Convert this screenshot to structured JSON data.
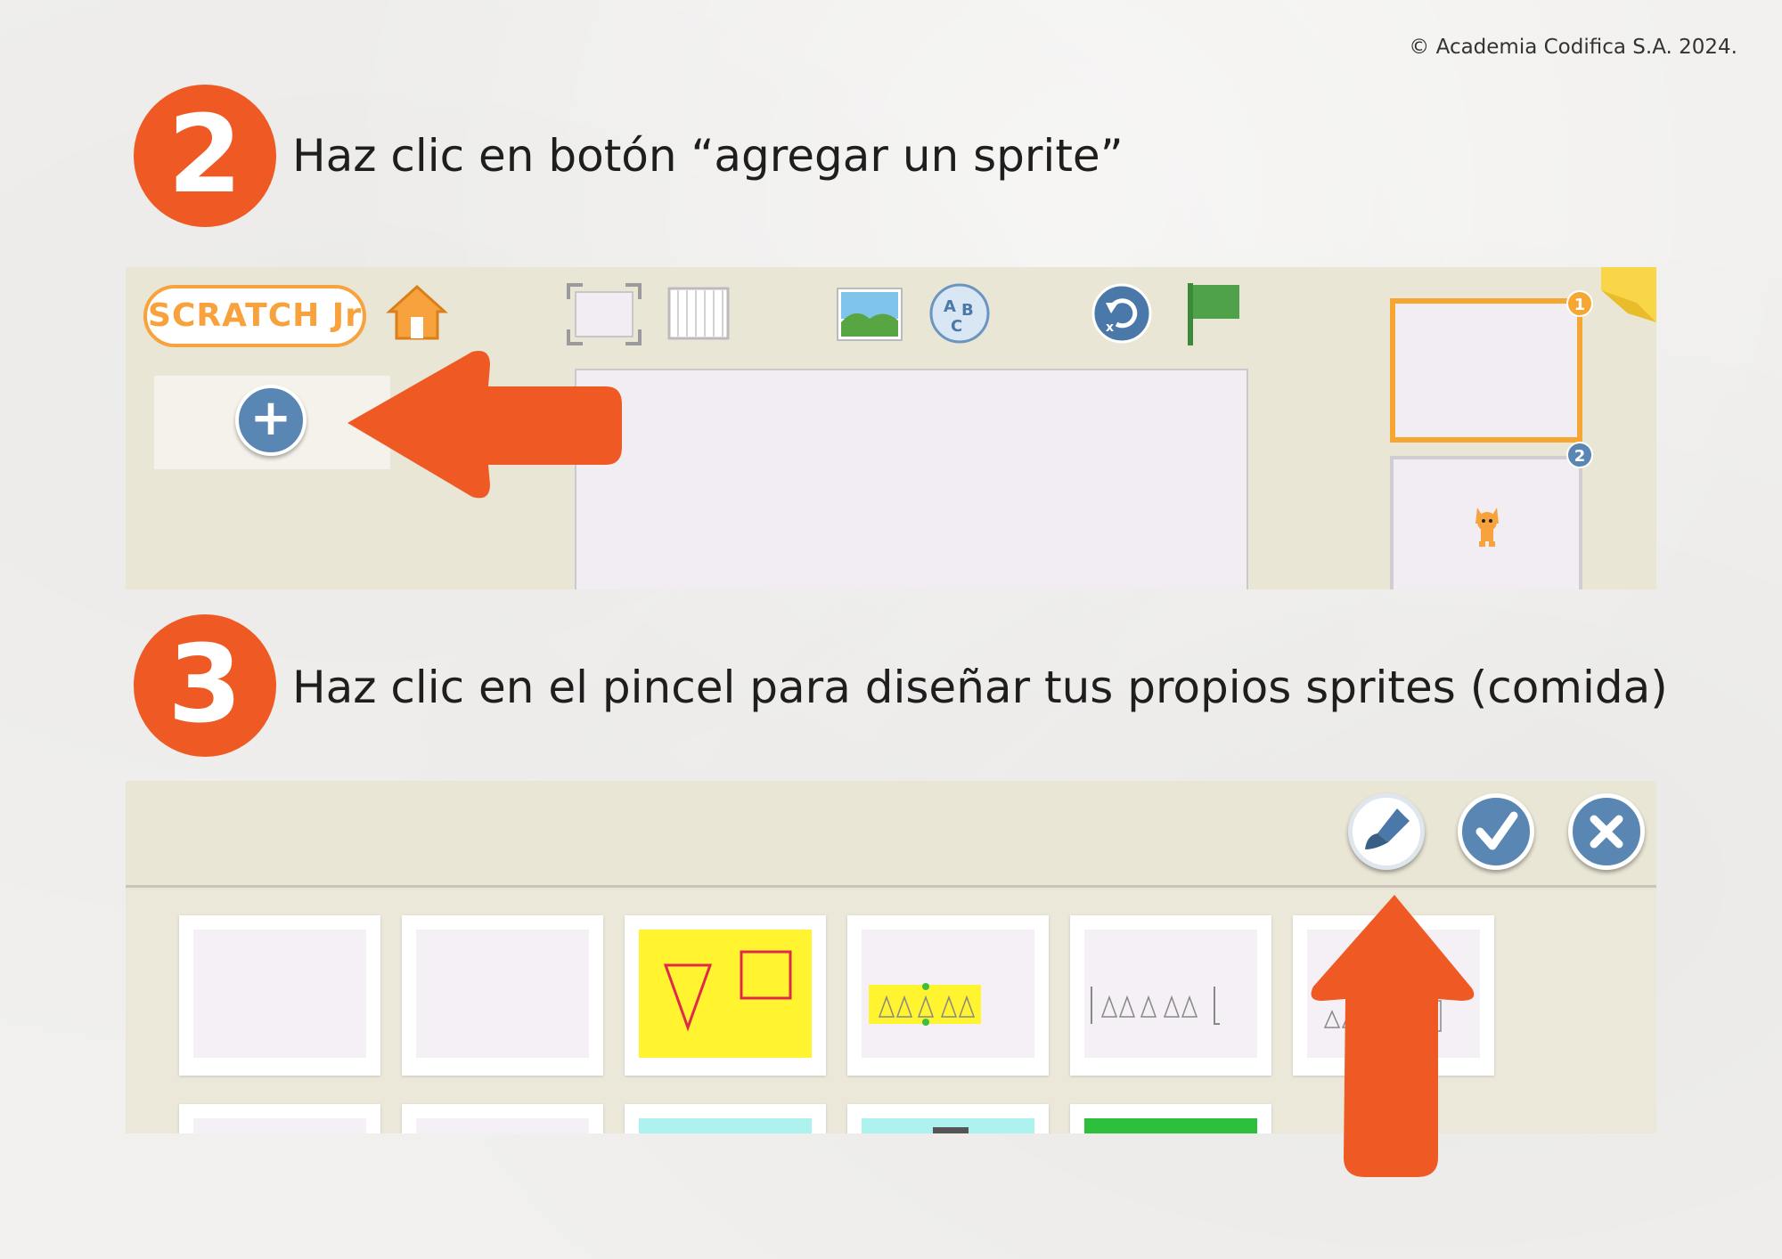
{
  "copyright": "© Academia Codifica S.A. 2024.",
  "steps": [
    {
      "number": "2",
      "text": "Haz clic en botón “agregar un sprite”"
    },
    {
      "number": "3",
      "text": "Haz clic en el pincel para diseñar tus propios sprites (comida)"
    }
  ],
  "app": {
    "logo": "SCRATCH Jr",
    "page_numbers": [
      "1",
      "2"
    ]
  },
  "colors": {
    "accent_orange": "#ef5a24",
    "scratch_blue": "#5a86b3",
    "page_selected": "#f6a733"
  },
  "icons": {
    "home": "home-icon",
    "add_sprite": "plus-icon",
    "paint": "paintbrush-icon",
    "confirm": "checkmark-icon",
    "close": "close-icon"
  }
}
